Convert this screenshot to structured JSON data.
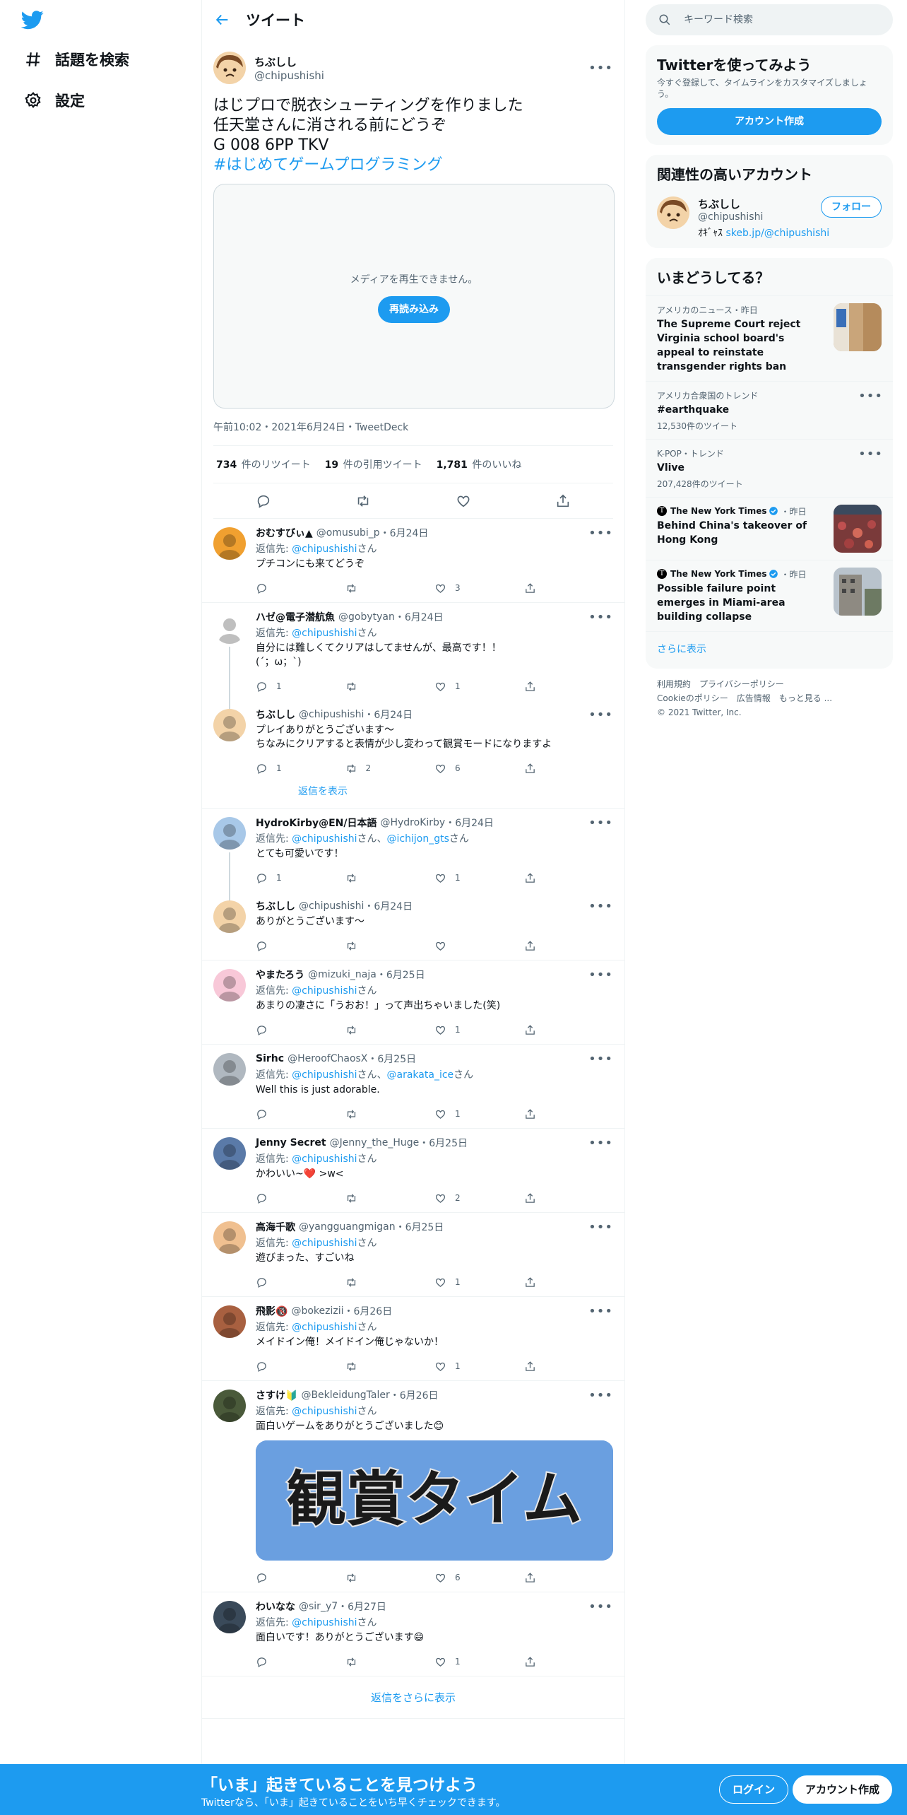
{
  "nav": {
    "logo_icon": "twitter-bird-icon",
    "explore_label": "話題を検索",
    "settings_label": "設定"
  },
  "header": {
    "title": "ツイート"
  },
  "main_tweet": {
    "name": "ちぶしし",
    "handle": "@chipushishi",
    "text_lines": [
      "はじプロで脱衣シューティングを作りました",
      "任天堂さんに消される前にどうぞ",
      "G 008 6PP TKV"
    ],
    "hashtag": "#はじめてゲームプログラミング",
    "media_message": "メディアを再生できません。",
    "reload_label": "再読み込み",
    "meta": "午前10:02・2021年6月24日・TweetDeck",
    "retweets": "734",
    "retweets_label": "件のリツイート",
    "quotes": "19",
    "quotes_label": "件の引用ツイート",
    "likes": "1,781",
    "likes_label": "件のいいね"
  },
  "replies": [
    {
      "name": "おむすびぃ▲",
      "handle": "@omusubi_p",
      "date": "・6月24日",
      "reply_prefix": "返信先: ",
      "reply_to": "@chipushishi",
      "reply_suffix": "さん",
      "text": "プチコンにも来てどうぞ",
      "replies": "",
      "retweets": "",
      "likes": "3"
    },
    {
      "name": "ハゼ@電子潜航魚",
      "handle": "@gobytyan",
      "date": "・6月24日",
      "reply_prefix": "返信先: ",
      "reply_to": "@chipushishi",
      "reply_suffix": "さん",
      "text": "自分には難しくてクリアはしてませんが、最高です！！",
      "text2": "(´；ω；`)",
      "replies": "1",
      "retweets": "",
      "likes": "1"
    },
    {
      "name": "ちぶしし",
      "handle": "@chipushishi",
      "date": "・6月24日",
      "text": "プレイありがとうございます～",
      "text2": "ちなみにクリアすると表情が少し変わって観賞モードになりますよ",
      "replies": "1",
      "retweets": "2",
      "likes": "6",
      "show_replies": "返信を表示"
    },
    {
      "name": "HydroKirby@EN/日本語",
      "handle": "@HydroKirby",
      "date": "・6月24日",
      "reply_prefix": "返信先: ",
      "reply_to": "@chipushishi",
      "reply_mid": "さん、",
      "reply_to2": "@ichijon_gts",
      "reply_suffix": "さん",
      "text": "とても可愛いです！",
      "replies": "1",
      "retweets": "",
      "likes": "1"
    },
    {
      "name": "ちぶしし",
      "handle": "@chipushishi",
      "date": "・6月24日",
      "text": "ありがとうございます～",
      "replies": "",
      "retweets": "",
      "likes": ""
    },
    {
      "name": "やまたろう",
      "handle": "@mizuki_naja",
      "date": "・6月25日",
      "reply_prefix": "返信先: ",
      "reply_to": "@chipushishi",
      "reply_suffix": "さん",
      "text": "あまりの凄さに「うおお！」って声出ちゃいました(笑)",
      "replies": "",
      "retweets": "",
      "likes": "1"
    },
    {
      "name": "Sirhc",
      "handle": "@HeroofChaosX",
      "date": "・6月25日",
      "reply_prefix": "返信先: ",
      "reply_to": "@chipushishi",
      "reply_mid": "さん、",
      "reply_to2": "@arakata_ice",
      "reply_suffix": "さん",
      "text": "Well this is just adorable.",
      "replies": "",
      "retweets": "",
      "likes": "1"
    },
    {
      "name": "Jenny Secret",
      "handle": "@Jenny_the_Huge",
      "date": "・6月25日",
      "reply_prefix": "返信先: ",
      "reply_to": "@chipushishi",
      "reply_suffix": "さん",
      "text": "かわいい~❤️ >w<",
      "replies": "",
      "retweets": "",
      "likes": "2"
    },
    {
      "name": "高海千歌",
      "handle": "@yangguangmigan",
      "date": "・6月25日",
      "reply_prefix": "返信先: ",
      "reply_to": "@chipushishi",
      "reply_suffix": "さん",
      "text": "遊びまった、すごいね",
      "replies": "",
      "retweets": "",
      "likes": "1"
    },
    {
      "name": "飛影🔞",
      "handle": "@bokezizii",
      "date": "・6月26日",
      "reply_prefix": "返信先: ",
      "reply_to": "@chipushishi",
      "reply_suffix": "さん",
      "text": "メイドイン俺！メイドイン俺じゃないか！",
      "replies": "",
      "retweets": "",
      "likes": "1"
    },
    {
      "name": "さすけ🔰",
      "handle": "@BekleidungTaler",
      "date": "・6月26日",
      "reply_prefix": "返信先: ",
      "reply_to": "@chipushishi",
      "reply_suffix": "さん",
      "text": "面白いゲームをありがとうございました😊",
      "image_text": "観賞タイム",
      "replies": "",
      "retweets": "",
      "likes": "6"
    },
    {
      "name": "わいなな",
      "handle": "@sir_y7",
      "date": "・6月27日",
      "reply_prefix": "返信先: ",
      "reply_to": "@chipushishi",
      "reply_suffix": "さん",
      "text": "面白いです！ありがとうございます😄",
      "replies": "",
      "retweets": "",
      "likes": "1"
    }
  ],
  "more_replies_label": "返信をさらに表示",
  "search": {
    "placeholder": "キーワード検索"
  },
  "signup_panel": {
    "title": "Twitterを使ってみよう",
    "subtitle": "今すぐ登録して、タイムラインをカスタマイズしましょう。",
    "button": "アカウント作成"
  },
  "related": {
    "title": "関連性の高いアカウント",
    "name": "ちぶしし",
    "handle": "@chipushishi",
    "bio_prefix": "ｵｷﾞｬｽ",
    "bio_link": "skeb.jp/@chipushishi",
    "follow_label": "フォロー"
  },
  "trends": {
    "title": "いまどうしてる？",
    "items": [
      {
        "meta": "アメリカのニュース・昨日",
        "title": "The Supreme Court reject Virginia school board's appeal to reinstate transgender rights ban",
        "sub": "",
        "has_thumb": true
      },
      {
        "meta": "アメリカ合衆国のトレンド",
        "title": "#earthquake",
        "sub": "12,530件のツイート"
      },
      {
        "meta": "K-POP・トレンド",
        "title": "Vlive",
        "sub": "207,428件のツイート"
      },
      {
        "meta_source": "The New York Times",
        "meta_time": "・昨日",
        "title": "Behind China's takeover of Hong Kong",
        "has_thumb": true
      },
      {
        "meta_source": "The New York Times",
        "meta_time": "・昨日",
        "title": "Possible failure point emerges in Miami-area building collapse",
        "has_thumb": true
      }
    ],
    "show_more": "さらに表示"
  },
  "footer": {
    "links_line1": [
      "利用規約",
      "プライバシーポリシー"
    ],
    "links_line2": [
      "Cookieのポリシー",
      "広告情報",
      "もっと見る ..."
    ],
    "copyright": "© 2021 Twitter, Inc."
  },
  "bottom_bar": {
    "title": "「いま」起きていることを見つけよう",
    "subtitle": "Twitterなら、「いま」起きていることをいち早くチェックできます。",
    "login": "ログイン",
    "signup": "アカウント作成"
  },
  "colors": {
    "accent": "#1d9bf0",
    "text": "#0f1419",
    "muted": "#536471",
    "border": "#eff3f4"
  }
}
